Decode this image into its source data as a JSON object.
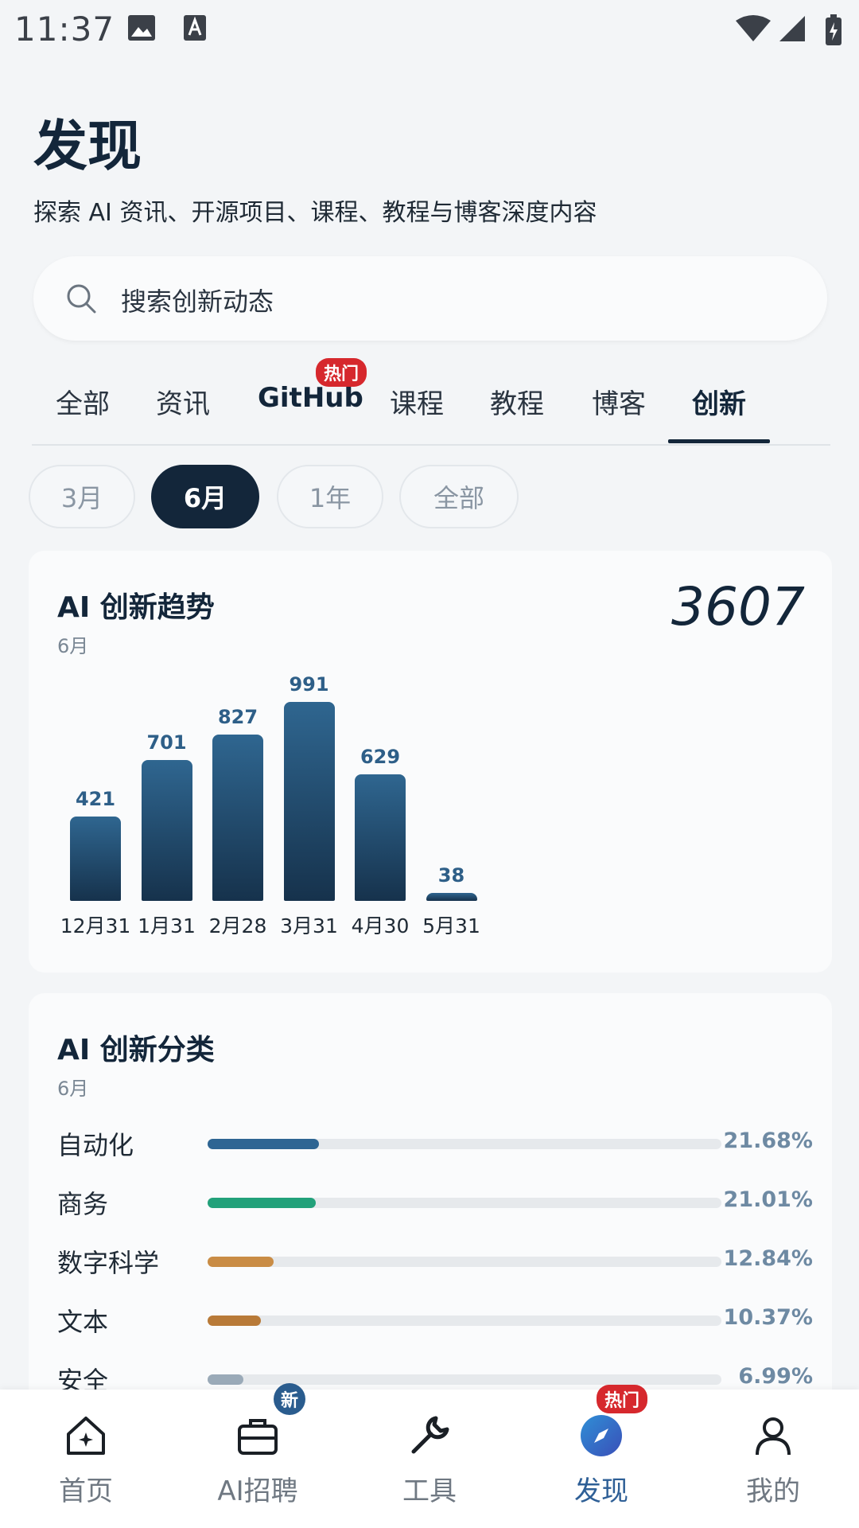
{
  "status": {
    "time": "11:37"
  },
  "header": {
    "title": "发现",
    "subtitle": "探索 AI 资讯、开源项目、课程、教程与博客深度内容"
  },
  "search": {
    "placeholder": "搜索创新动态"
  },
  "tabs": [
    {
      "label": "全部"
    },
    {
      "label": "资讯"
    },
    {
      "label": "GitHub",
      "badge": "热门"
    },
    {
      "label": "课程"
    },
    {
      "label": "教程"
    },
    {
      "label": "博客"
    },
    {
      "label": "创新",
      "active": true
    }
  ],
  "periods": [
    {
      "label": "3月"
    },
    {
      "label": "6月",
      "active": true
    },
    {
      "label": "1年"
    },
    {
      "label": "全部"
    }
  ],
  "trend_card": {
    "title": "AI 创新趋势",
    "period": "6月",
    "total": "3607"
  },
  "category_card": {
    "title": "AI 创新分类",
    "period": "6月",
    "items": [
      {
        "label": "自动化",
        "pct_text": "21.68%",
        "pct": 21.68,
        "color": "#2e6593"
      },
      {
        "label": "商务",
        "pct_text": "21.01%",
        "pct": 21.01,
        "color": "#22a17a"
      },
      {
        "label": "数字科学",
        "pct_text": "12.84%",
        "pct": 12.84,
        "color": "#c98c45"
      },
      {
        "label": "文本",
        "pct_text": "10.37%",
        "pct": 10.37,
        "color": "#b87a38"
      },
      {
        "label": "安全",
        "pct_text": "6.99%",
        "pct": 6.99,
        "color": "#9aaab8"
      }
    ]
  },
  "chart_data": {
    "type": "bar",
    "categories": [
      "12月31",
      "1月31",
      "2月28",
      "3月31",
      "4月30",
      "5月31"
    ],
    "values": [
      421,
      701,
      827,
      991,
      629,
      38
    ]
  },
  "bottom_nav": [
    {
      "label": "首页",
      "icon": "home-icon"
    },
    {
      "label": "AI招聘",
      "icon": "briefcase-icon",
      "badge": "新"
    },
    {
      "label": "工具",
      "icon": "wrench-icon"
    },
    {
      "label": "发现",
      "icon": "compass-icon",
      "badge": "热门",
      "active": true
    },
    {
      "label": "我的",
      "icon": "user-icon"
    }
  ],
  "colors": {
    "primary": "#13263a",
    "accent": "#2e5f96",
    "hot": "#d6282d"
  }
}
